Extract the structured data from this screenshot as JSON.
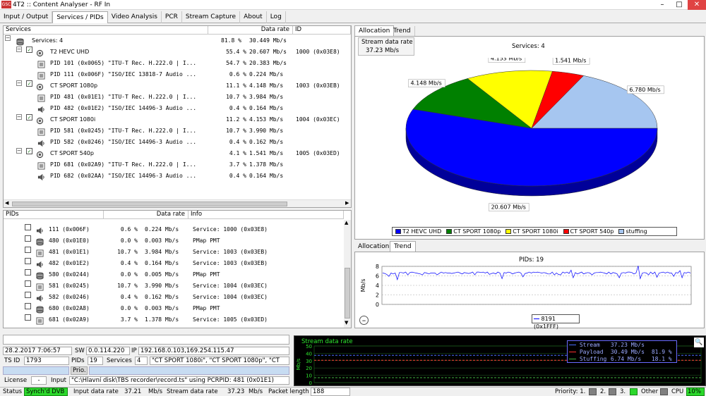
{
  "window": {
    "title": "4T2 :: Content Analyser - RF In",
    "app_icon_text": "GSC"
  },
  "menu_tabs": [
    "Input / Output",
    "Services / PIDs",
    "Video Analysis",
    "PCR",
    "Stream Capture",
    "About",
    "Log"
  ],
  "services_table": {
    "headers": [
      "Services",
      "Data rate",
      "ID"
    ],
    "root": {
      "label": "Services: 4",
      "pct": "81.8 %",
      "rate": "30.449 Mb/s"
    },
    "rows": [
      {
        "kind": "service",
        "name": "T2 HEVC UHD",
        "pct": "55.4 %",
        "rate": "20.607 Mb/s",
        "id": "1000 (0x03E8)"
      },
      {
        "kind": "pid",
        "icon": "video",
        "name": "PID 101 (0x0065) \"ITU-T Rec. H.222.0 | I...",
        "pct": "54.7 %",
        "rate": "20.383 Mb/s",
        "id": ""
      },
      {
        "kind": "pid",
        "icon": "video",
        "name": "PID 111 (0x006F) \"ISO/IEC 13818-7 Audio ...",
        "pct": "0.6 %",
        "rate": "0.224 Mb/s",
        "id": ""
      },
      {
        "kind": "service",
        "name": "CT SPORT 1080p",
        "pct": "11.1 %",
        "rate": "4.148 Mb/s",
        "id": "1003 (0x03EB)"
      },
      {
        "kind": "pid",
        "icon": "video",
        "name": "PID 481 (0x01E1) \"ITU-T Rec. H.222.0 | I...",
        "pct": "10.7 %",
        "rate": "3.984 Mb/s",
        "id": ""
      },
      {
        "kind": "pid",
        "icon": "audio",
        "name": "PID 482 (0x01E2) \"ISO/IEC 14496-3 Audio ...",
        "pct": "0.4 %",
        "rate": "0.164 Mb/s",
        "id": ""
      },
      {
        "kind": "service",
        "name": "CT SPORT 1080i",
        "pct": "11.2 %",
        "rate": "4.153 Mb/s",
        "id": "1004 (0x03EC)"
      },
      {
        "kind": "pid",
        "icon": "video",
        "name": "PID 581 (0x0245) \"ITU-T Rec. H.222.0 | I...",
        "pct": "10.7 %",
        "rate": "3.990 Mb/s",
        "id": ""
      },
      {
        "kind": "pid",
        "icon": "audio",
        "name": "PID 582 (0x0246) \"ISO/IEC 14496-3 Audio ...",
        "pct": "0.4 %",
        "rate": "0.162 Mb/s",
        "id": ""
      },
      {
        "kind": "service",
        "name": "CT SPORT 540p",
        "pct": "4.1 %",
        "rate": "1.541 Mb/s",
        "id": "1005 (0x03ED)"
      },
      {
        "kind": "pid",
        "icon": "video",
        "name": "PID 681 (0x02A9) \"ITU-T Rec. H.222.0 | I...",
        "pct": "3.7 %",
        "rate": "1.378 Mb/s",
        "id": ""
      },
      {
        "kind": "pid",
        "icon": "audio",
        "name": "PID 682 (0x02AA) \"ISO/IEC 14496-3 Audio ...",
        "pct": "0.4 %",
        "rate": "0.164 Mb/s",
        "id": ""
      }
    ]
  },
  "pids_table": {
    "headers": [
      "PIDs",
      "Data rate",
      "Info"
    ],
    "rows": [
      {
        "icon": "audio",
        "pid": "111 (0x006F)",
        "pct": "0.6 %",
        "rate": "0.224 Mb/s",
        "info": "Service: 1000 (0x03E8)"
      },
      {
        "icon": "db",
        "pid": "480 (0x01E0)",
        "pct": "0.0 %",
        "rate": "0.003 Mb/s",
        "info": "PMap PMT"
      },
      {
        "icon": "video",
        "pid": "481 (0x01E1)",
        "pct": "10.7 %",
        "rate": "3.984 Mb/s",
        "info": "Service: 1003 (0x03EB)"
      },
      {
        "icon": "audio",
        "pid": "482 (0x01E2)",
        "pct": "0.4 %",
        "rate": "0.164 Mb/s",
        "info": "Service: 1003 (0x03EB)"
      },
      {
        "icon": "db",
        "pid": "580 (0x0244)",
        "pct": "0.0 %",
        "rate": "0.005 Mb/s",
        "info": "PMap PMT"
      },
      {
        "icon": "video",
        "pid": "581 (0x0245)",
        "pct": "10.7 %",
        "rate": "3.990 Mb/s",
        "info": "Service: 1004 (0x03EC)"
      },
      {
        "icon": "audio",
        "pid": "582 (0x0246)",
        "pct": "0.4 %",
        "rate": "0.162 Mb/s",
        "info": "Service: 1004 (0x03EC)"
      },
      {
        "icon": "db",
        "pid": "680 (0x02A8)",
        "pct": "0.0 %",
        "rate": "0.003 Mb/s",
        "info": "PMap PMT"
      },
      {
        "icon": "video",
        "pid": "681 (0x02A9)",
        "pct": "3.7 %",
        "rate": "1.378 Mb/s",
        "info": "Service: 1005 (0x03ED)"
      }
    ]
  },
  "allocation": {
    "tabs": [
      "Allocation",
      "Trend"
    ],
    "stream_rate_label": "Stream data rate",
    "stream_rate_value": "37.23 Mb/s",
    "pie_title": "Services: 4",
    "legend": [
      {
        "name": "T2 HEVC UHD",
        "color": "#0000ff"
      },
      {
        "name": "CT SPORT 1080p",
        "color": "#008000"
      },
      {
        "name": "CT SPORT 1080i",
        "color": "#ffff00"
      },
      {
        "name": "CT SPORT 540p",
        "color": "#ff0000"
      },
      {
        "name": "stuffing",
        "color": "#a6c6f0"
      }
    ]
  },
  "trend": {
    "tabs": [
      "Allocation",
      "Trend"
    ],
    "legend_entry": "8191 (0x1FFF)",
    "zoom_icon": "zoom-out-icon"
  },
  "chart_data": [
    {
      "type": "pie",
      "title": "Services: 4",
      "categories": [
        "T2 HEVC UHD",
        "CT SPORT 1080p",
        "CT SPORT 1080i",
        "CT SPORT 540p",
        "stuffing"
      ],
      "values": [
        20.607,
        4.148,
        4.153,
        1.541,
        6.78
      ],
      "labels": [
        "20.607 Mb/s",
        "4.148 Mb/s",
        "4.153 Mb/s",
        "1.541 Mb/s",
        "6.780 Mb/s"
      ],
      "colors": [
        "#0000ff",
        "#008000",
        "#ffff00",
        "#ff0000",
        "#a6c6f0"
      ],
      "legend": "bottom"
    },
    {
      "type": "line",
      "title": "PIDs: 19",
      "ylabel": "Mb/s",
      "ylim": [
        0,
        8
      ],
      "yticks": [
        "8",
        "6",
        "4",
        "2",
        "0"
      ],
      "grid": true,
      "series": [
        {
          "name": "8191 (0x1FFF)",
          "color": "#0000ff",
          "values": [
            6.6,
            6.5,
            6.3,
            5.9,
            6.6,
            6.4,
            6.6,
            5.2,
            6.7,
            6.7,
            6.6,
            6.8,
            6.2,
            6.7,
            6.8,
            6.7,
            6.6,
            6.5,
            6.4,
            6.2,
            6.7,
            6.6,
            6.4,
            6.6,
            6.6,
            6.6,
            6.2,
            6.5,
            6.8,
            6.6,
            6.7,
            6.6,
            6.6,
            6.5,
            6.6,
            6.7,
            6.8,
            6.6,
            6.4,
            6.7,
            6.6,
            6.5,
            6.6,
            6.8,
            6.2,
            6.8,
            6.8,
            6.7,
            6.8,
            6.6,
            6.8,
            6.3,
            6.5,
            6.6,
            6.4,
            6.8,
            6.6,
            5.4,
            6.7,
            6.6,
            6.8,
            6.7,
            6.4,
            6.6,
            6.7,
            6.8,
            6.6,
            5.8,
            6.5,
            6.6,
            6.8,
            6.6,
            6.8,
            6.7,
            6.8,
            6.7,
            6.6,
            6.7,
            6.6,
            6.4,
            6.4,
            6.8,
            6.2,
            6.6,
            6.3,
            6.2,
            6.8,
            6.6,
            6.8,
            6.5,
            7.2,
            5.6,
            6.7,
            6.4,
            6.6,
            6.8,
            6.4,
            6.6,
            6.7,
            6.6,
            6.2,
            6.6,
            6.7,
            6.7,
            6.8,
            6.7,
            6.6,
            6.4,
            6.8,
            6.4,
            6.7,
            6.6,
            6.4,
            5.6,
            6.6,
            6.7,
            6.6,
            6.8,
            6.8,
            6.7,
            6.4,
            6.6,
            8.1,
            5.4,
            6.6,
            6.7,
            6.6,
            6.2,
            6.8,
            6.4,
            6.8,
            5.7,
            6.6,
            6.7,
            6.8,
            6.6,
            6.8,
            6.6,
            6.6,
            5.9,
            6.7,
            6.6,
            7.1,
            5.6,
            6.7,
            6.6,
            6.8,
            6.6
          ]
        }
      ]
    },
    {
      "type": "line",
      "title": "Stream data rate",
      "ylabel": "Mb/s",
      "ylim": [
        0,
        50
      ],
      "yticks": [
        "50",
        "40",
        "30",
        "20",
        "10",
        "0"
      ],
      "series": [
        {
          "name": "Stream",
          "color": "#4a6cff",
          "values": [
            37.2,
            37.2,
            37.2,
            37.2,
            37.2,
            37.2,
            37.2,
            37.2,
            37.2,
            37.2
          ]
        },
        {
          "name": "Payload",
          "color": "#ff3030",
          "values": [
            30.5,
            30.5,
            30.5,
            30.5,
            30.5,
            30.5,
            30.5,
            30.5,
            30.5,
            30.5
          ]
        },
        {
          "name": "Stuffing",
          "color": "#40b040",
          "values": [
            6.7,
            6.7,
            6.7,
            6.7,
            6.7,
            6.7,
            6.7,
            6.7,
            6.7,
            6.7
          ]
        }
      ],
      "legend_rows": [
        {
          "name": "Stream",
          "rate": "37.23 Mb/s",
          "pct": ""
        },
        {
          "name": "Payload",
          "rate": "30.49 Mb/s",
          "pct": "81.9 %"
        },
        {
          "name": "Stuffing",
          "rate": "6.74 Mb/s",
          "pct": "18.1 %"
        }
      ]
    }
  ],
  "status": {
    "datetime": "28.2.2017 7:06:57",
    "sw_label": "SW",
    "sw_value": "0.0.114.220",
    "ip_label": "IP",
    "ip_value": "192.168.0.103,169.254.115.47",
    "tsid_label": "TS ID",
    "tsid_value": "1793 (0x0701)",
    "pids_label": "PIDs",
    "pids_value": "19",
    "services_label": "Services",
    "services_value": "4",
    "services_list": "\"CT SPORT 1080i\", \"CT SPORT 1080p\", \"CT SP",
    "prio_label": "Prio.",
    "license_label": "License",
    "license_value": "-",
    "input_label": "Input",
    "input_value": "\"C:\\Hlavní disk\\TBS recorder\\record.ts\" using PCRPID: 481 (0x01E1) (Dat",
    "status_label": "Status",
    "status_value": "Synch'd DVB",
    "input_rate_label": "Input data rate",
    "input_rate_value": "37.21",
    "stream_rate_label": "Stream data rate",
    "stream_rate_value": "37.23",
    "unit": "Mb/s",
    "packet_length_label": "Packet length",
    "packet_length_value": "188",
    "priority_label": "Priority: 1.",
    "p2": "2.",
    "p3": "3.",
    "other_label": "Other",
    "cpu_label": "CPU",
    "cpu_value": "10%"
  }
}
